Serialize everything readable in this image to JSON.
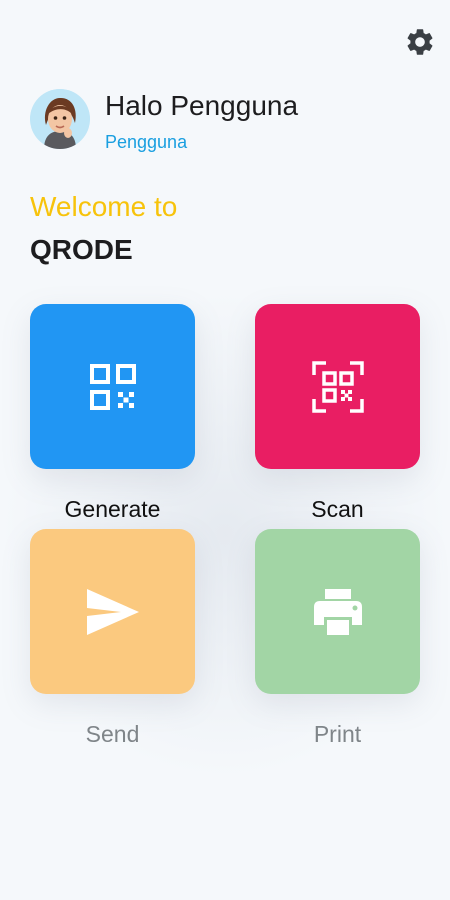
{
  "header": {
    "settings_icon": "gear-icon",
    "settings_color": "#3a3f44"
  },
  "profile": {
    "avatar": "memoji-avatar",
    "name": "Halo Pengguna",
    "role": "Pengguna"
  },
  "welcome": {
    "greeting": "Welcome to",
    "app_name": "QRODE"
  },
  "menu": {
    "items": [
      {
        "label": "Generate",
        "icon": "qr-code-icon",
        "color": "#2196f3"
      },
      {
        "label": "Scan",
        "icon": "qr-scan-icon",
        "color": "#e91e63"
      },
      {
        "label": "Send",
        "icon": "send-icon",
        "color": "#fbc97f"
      },
      {
        "label": "Print",
        "icon": "printer-icon",
        "color": "#a2d5a5"
      }
    ]
  },
  "colors": {
    "background": "#f5f8fb",
    "accent_yellow": "#f7c30b",
    "accent_blue": "#1a9fe0"
  }
}
